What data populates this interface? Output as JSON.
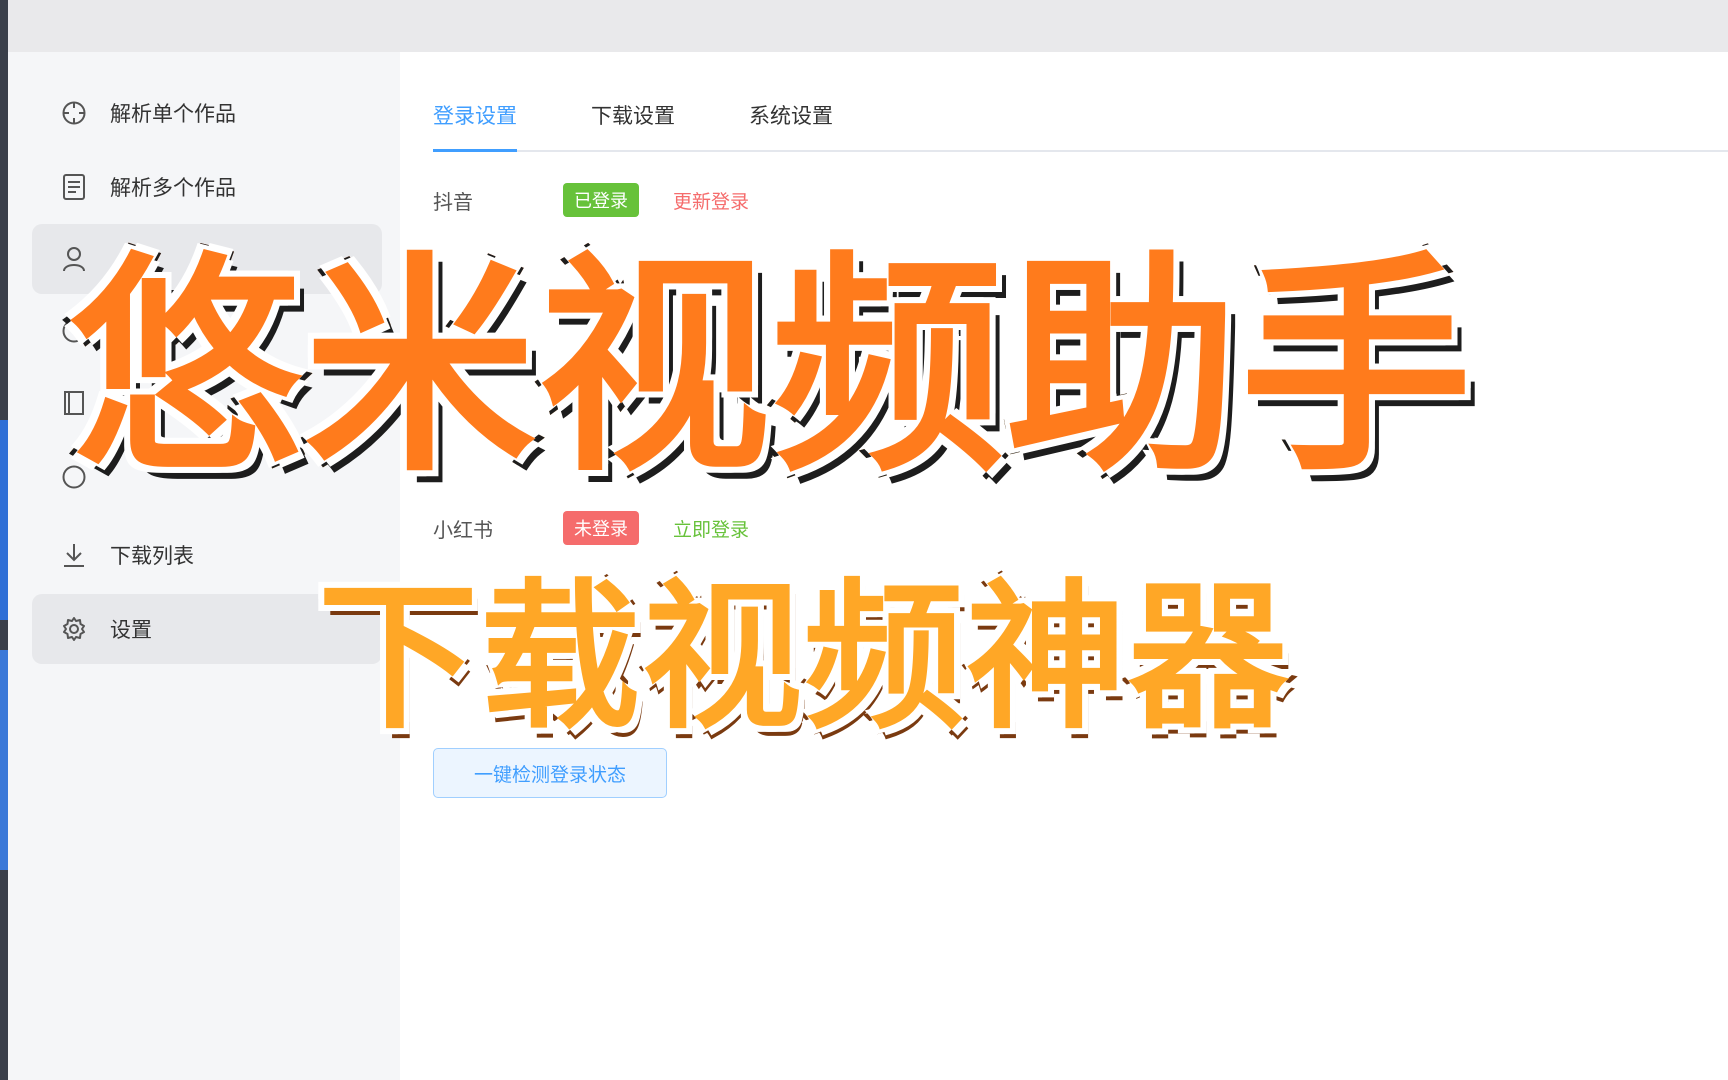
{
  "sidebar": {
    "items": [
      {
        "label": "解析单个作品",
        "icon": "crosshair-icon"
      },
      {
        "label": "解析多个作品",
        "icon": "document-icon"
      },
      {
        "label": "",
        "icon": "user-icon"
      },
      {
        "label": "",
        "icon": "clock-icon"
      },
      {
        "label": "",
        "icon": "book-icon"
      },
      {
        "label": "",
        "icon": "clock-icon"
      },
      {
        "label": "下载列表",
        "icon": "download-icon"
      },
      {
        "label": "设置",
        "icon": "gear-icon"
      }
    ]
  },
  "tabs": [
    {
      "label": "登录设置",
      "active": true
    },
    {
      "label": "下载设置",
      "active": false
    },
    {
      "label": "系统设置",
      "active": false
    }
  ],
  "accounts": [
    {
      "platform": "抖音",
      "status": "已登录",
      "action": "更新登录"
    },
    {
      "platform": "小红书",
      "status": "未登录",
      "action": "立即登录"
    }
  ],
  "check_button": "一键检测登录状态",
  "overlay": {
    "title": "悠米视频助手",
    "subtitle": "下载视频神器"
  },
  "colors": {
    "accent": "#409eff",
    "success": "#67c23a",
    "danger": "#f56c6c",
    "title_orange": "#ff7b1c"
  }
}
